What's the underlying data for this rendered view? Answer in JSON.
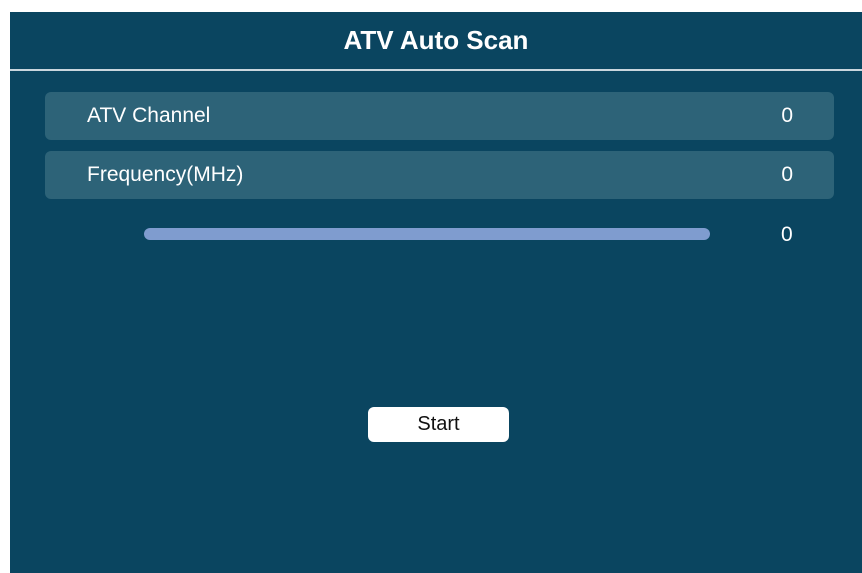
{
  "header": {
    "title": "ATV Auto Scan"
  },
  "rows": [
    {
      "label": "ATV Channel",
      "value": "0"
    },
    {
      "label": "Frequency(MHz)",
      "value": "0"
    }
  ],
  "progress": {
    "value_text": "0",
    "fraction": 0
  },
  "actions": {
    "start_label": "Start"
  },
  "colors": {
    "background": "#0a4560",
    "row_background": "#2d6378",
    "progress_track": "#7f9ccf",
    "button_background": "#ffffff"
  }
}
